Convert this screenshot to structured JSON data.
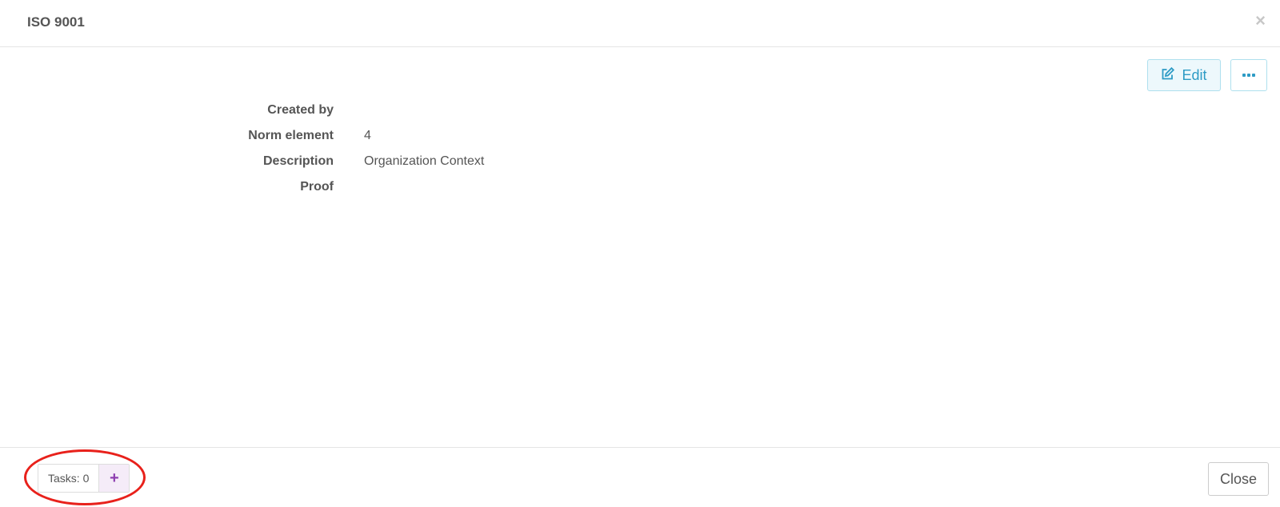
{
  "header": {
    "title": "ISO 9001",
    "close_glyph": "×"
  },
  "toolbar": {
    "edit_label": "Edit",
    "edit_icon": "edit-icon",
    "more_icon": "ellipsis-icon"
  },
  "details": [
    {
      "label": "Created by",
      "value": ""
    },
    {
      "label": "Norm element",
      "value": "4"
    },
    {
      "label": "Description",
      "value": "Organization Context"
    },
    {
      "label": "Proof",
      "value": ""
    }
  ],
  "footer": {
    "tasks_label": "Tasks: 0",
    "add_task_glyph": "+",
    "close_label": "Close"
  },
  "colors": {
    "accent": "#2d9bc5",
    "task_add": "#8e3fb0",
    "highlight": "#e8211b"
  }
}
